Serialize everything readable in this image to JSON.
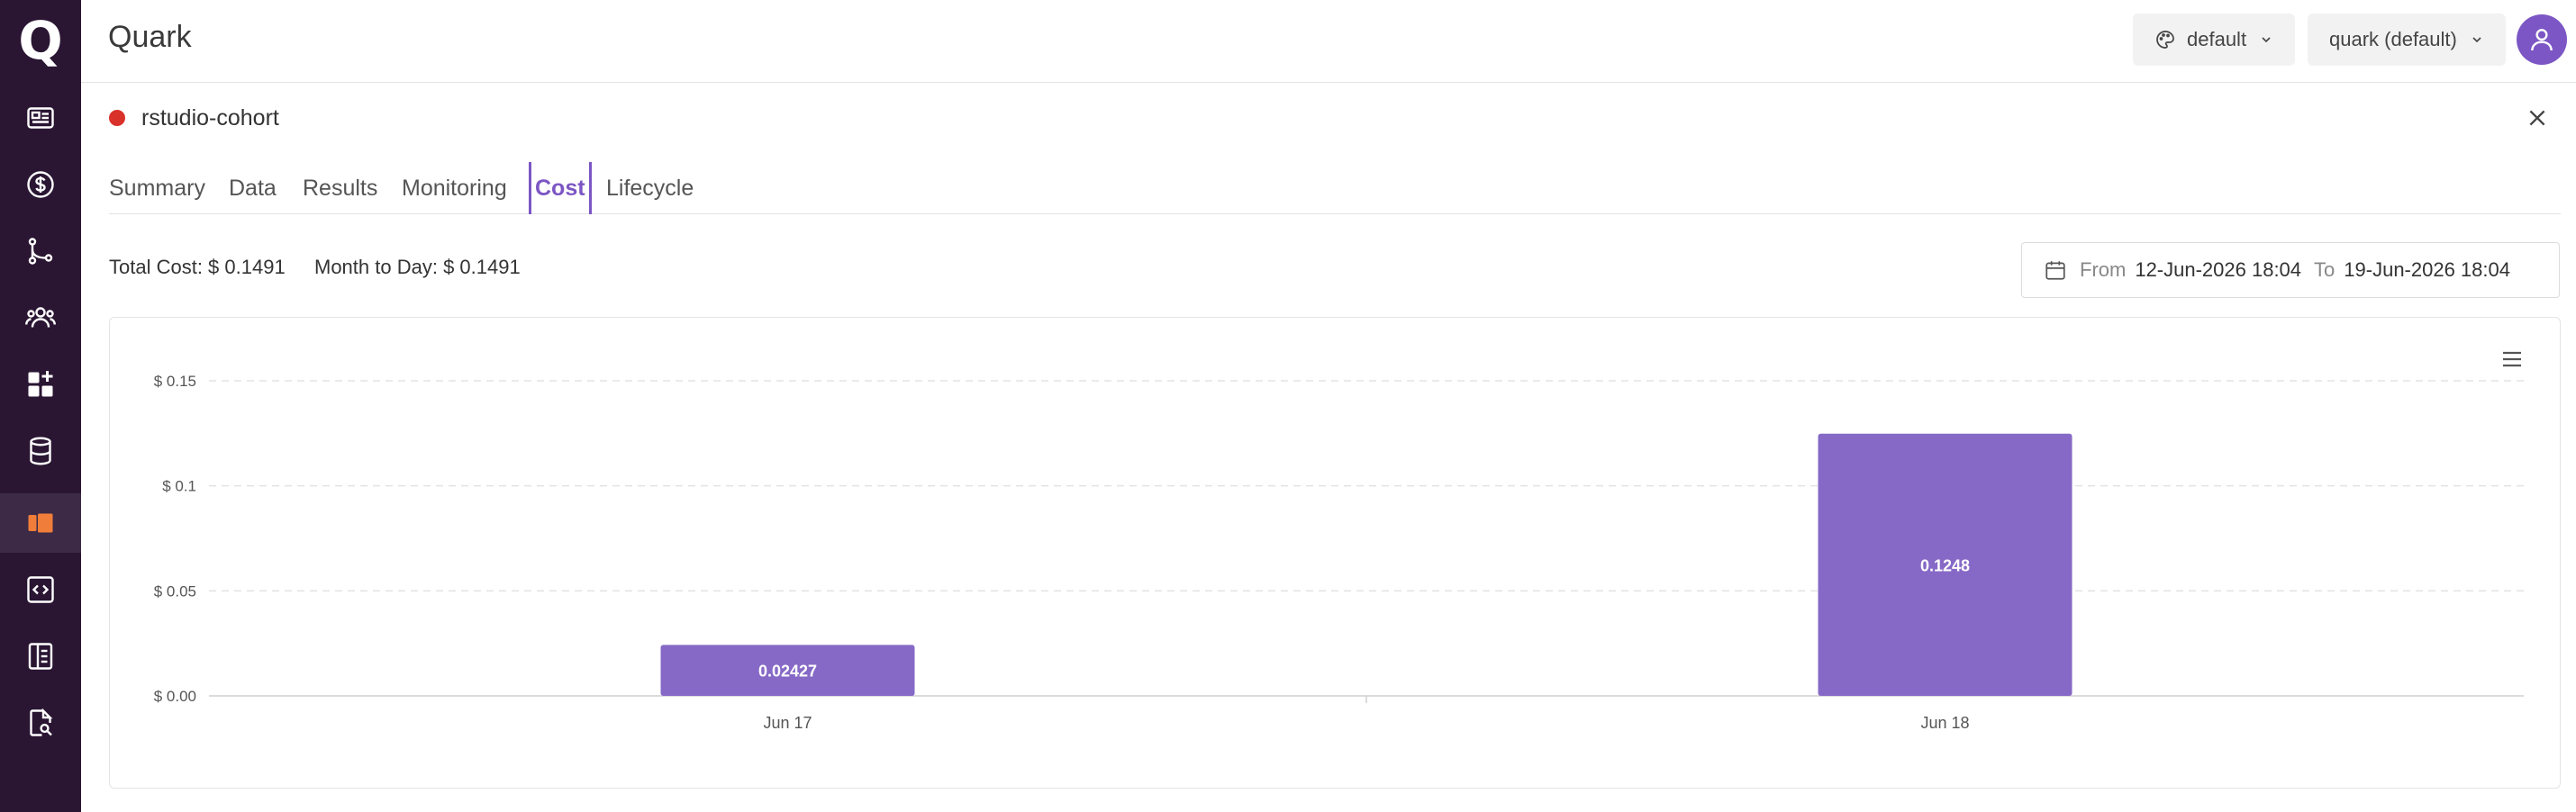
{
  "app": {
    "logo_letter": "Q",
    "title": "Quark"
  },
  "header": {
    "theme_label": "default",
    "workspace_label": "quark (default)"
  },
  "sidebar": {
    "items": [
      {
        "icon": "dashboard-card-icon"
      },
      {
        "icon": "dollar-icon"
      },
      {
        "icon": "pipeline-icon"
      },
      {
        "icon": "users-icon"
      },
      {
        "icon": "add-widget-icon"
      },
      {
        "icon": "database-icon"
      },
      {
        "icon": "cohort-icon",
        "active": true
      },
      {
        "icon": "code-icon"
      },
      {
        "icon": "report-icon"
      },
      {
        "icon": "file-search-icon"
      }
    ]
  },
  "resource": {
    "name": "rstudio-cohort",
    "status_color": "#d9322a"
  },
  "tabs": [
    {
      "label": "Summary"
    },
    {
      "label": "Data"
    },
    {
      "label": "Results"
    },
    {
      "label": "Monitoring"
    },
    {
      "label": "Cost",
      "active": true
    },
    {
      "label": "Lifecycle"
    }
  ],
  "cost": {
    "total": "Total Cost: $ 0.1491",
    "month_to_day": "Month to Day: $ 0.1491"
  },
  "date_range": {
    "from_label": "From",
    "from_value": "12-Jun-2026 18:04",
    "to_label": "To",
    "to_value": "19-Jun-2026 18:04"
  },
  "colors": {
    "accent": "#7c56c4",
    "bar": "#8669c6",
    "sidebar_bg": "#2a1533"
  },
  "chart_data": {
    "type": "bar",
    "categories": [
      "Jun 17",
      "Jun 18"
    ],
    "values": [
      0.02427,
      0.1248
    ],
    "data_labels": [
      "0.02427",
      "0.1248"
    ],
    "y_ticks": [
      {
        "value": 0,
        "label": "$ 0.00"
      },
      {
        "value": 0.05,
        "label": "$ 0.05"
      },
      {
        "value": 0.1,
        "label": "$ 0.1"
      },
      {
        "value": 0.15,
        "label": "$ 0.15"
      }
    ],
    "ylim": [
      0,
      0.15
    ],
    "grid": true,
    "legend": "none"
  }
}
